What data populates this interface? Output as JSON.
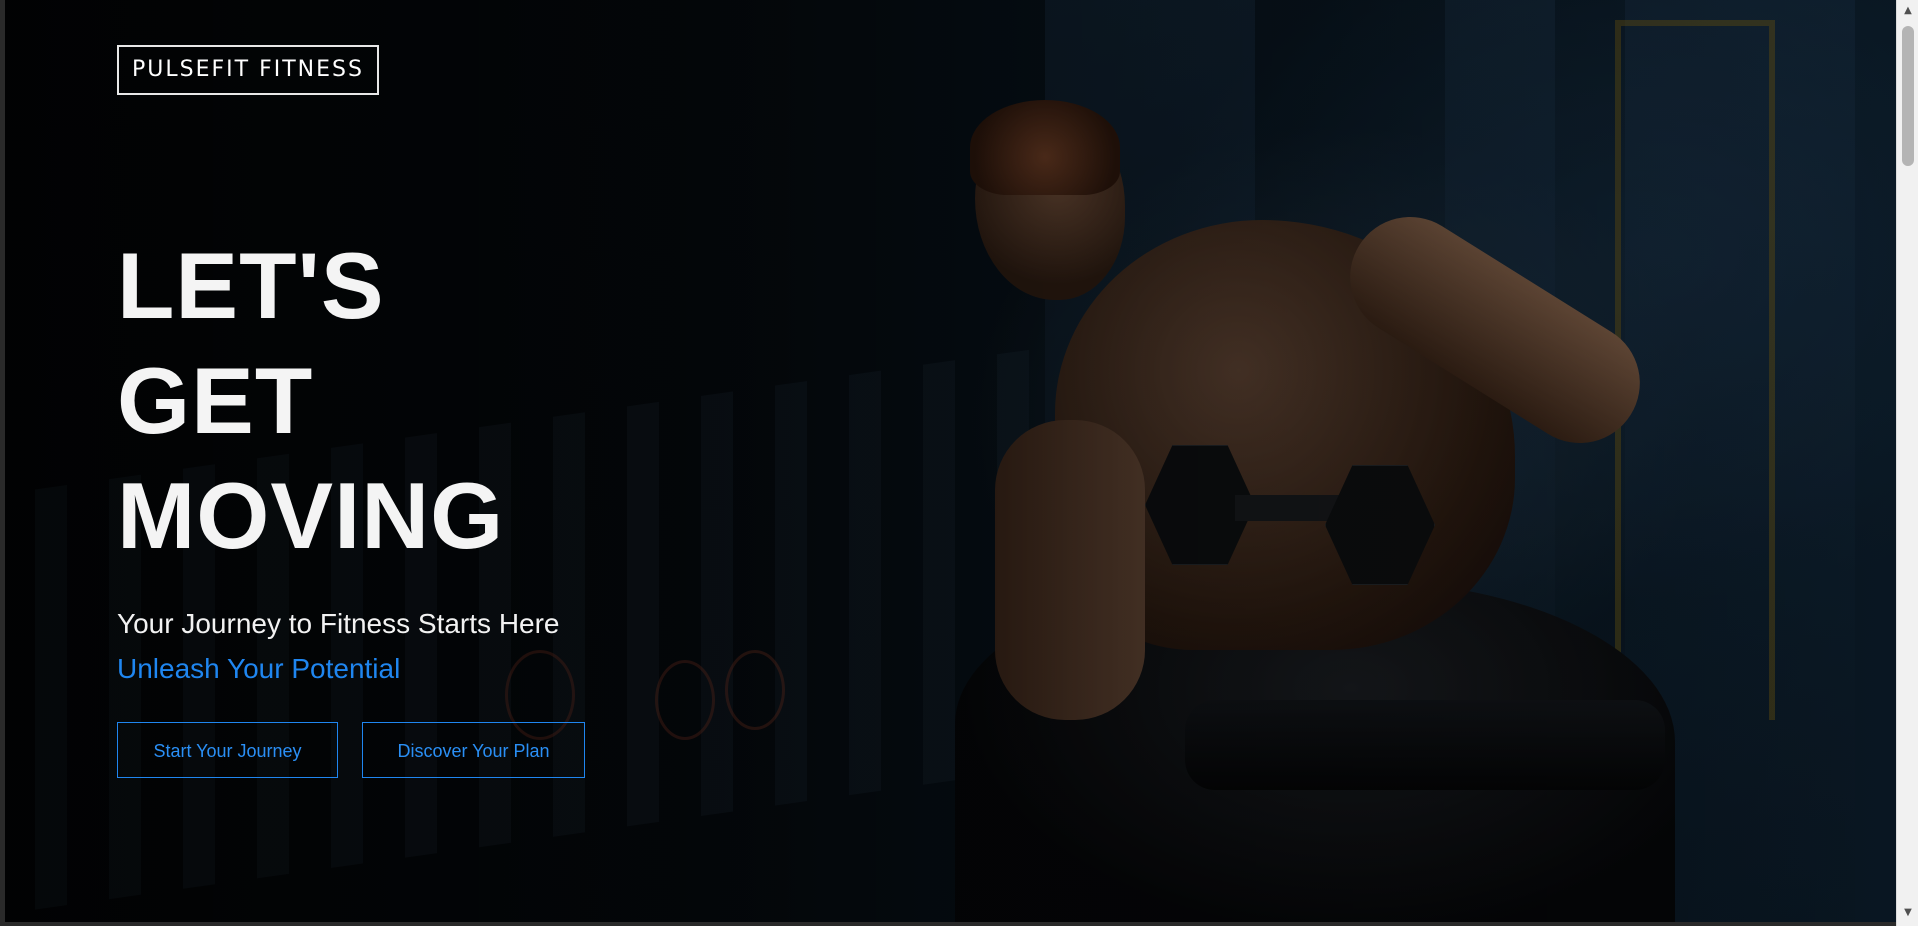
{
  "brand": {
    "logo_text": "PULSEFIT FITNESS"
  },
  "hero": {
    "title_lines": [
      "LET'S",
      "GET",
      "MOVING"
    ],
    "subtitle": "Your Journey to Fitness Starts Here",
    "tagline": "Unleash Your Potential"
  },
  "actions": {
    "start_label": "Start Your Journey",
    "discover_label": "Discover Your Plan"
  },
  "scrollbar": {
    "up_icon": "▲",
    "down_icon": "▼"
  },
  "colors": {
    "accent": "#1f86f0",
    "text": "#f4f4f4",
    "background": "#05090d"
  }
}
